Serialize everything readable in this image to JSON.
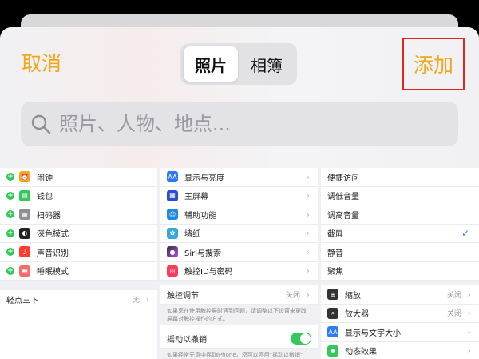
{
  "header": {
    "cancel": "取消",
    "add": "添加",
    "segments": [
      {
        "label": "照片",
        "active": true
      },
      {
        "label": "相簿",
        "active": false
      }
    ],
    "search_placeholder": "照片、人物、地点..."
  },
  "gallery": {
    "col1": {
      "items": [
        {
          "label": "闹钟",
          "icon": "alarm-icon",
          "color": "#f5a623"
        },
        {
          "label": "钱包",
          "icon": "wallet-icon",
          "color": "#34c759"
        },
        {
          "label": "扫码器",
          "icon": "qr-icon",
          "color": "#8e8e93"
        },
        {
          "label": "深色模式",
          "icon": "dark-mode-icon",
          "color": "#222222"
        },
        {
          "label": "声音识别",
          "icon": "sound-icon",
          "color": "#ff3b30"
        },
        {
          "label": "睡眠模式",
          "icon": "bed-icon",
          "color": "#ff6b6b"
        }
      ],
      "bottom_label": "轻点三下",
      "bottom_value": "无"
    },
    "col2": {
      "items": [
        {
          "label": "显示与亮度",
          "icon": "AA",
          "color": "#2d7cf6"
        },
        {
          "label": "主屏幕",
          "icon": "grid",
          "color": "#2d4bd3"
        },
        {
          "label": "辅助功能",
          "icon": "person",
          "color": "#1e88e5"
        },
        {
          "label": "墙纸",
          "icon": "flower",
          "color": "#36aadf"
        },
        {
          "label": "Siri与搜索",
          "icon": "siri",
          "color": "#333333"
        },
        {
          "label": "触控ID与密码",
          "icon": "fingerprint",
          "color": "#ff3b5c"
        }
      ],
      "touch_label": "触控调节",
      "touch_value": "关闭",
      "touch_note": "如果您在使用触控屏时遇到问题，请调整以下设置来更改屏幕对触控操作的方式。",
      "shake_label": "摇动以撤销",
      "shake_note": "如果经常无意中摇动iPhone，您可以停用\"摇动以撤销\""
    },
    "col3": {
      "items": [
        {
          "label": "便捷访问"
        },
        {
          "label": "调低音量"
        },
        {
          "label": "调高音量"
        },
        {
          "label": "截屏",
          "checked": true
        },
        {
          "label": "静音"
        },
        {
          "label": "聚焦"
        }
      ],
      "rows": [
        {
          "label": "缩放",
          "value": "关闭",
          "color": "#333333"
        },
        {
          "label": "放大器",
          "value": "关闭",
          "color": "#333333"
        },
        {
          "label": "显示与文字大小",
          "value": "",
          "color": "#2d7cf6"
        },
        {
          "label": "动态效果",
          "value": "",
          "color": "#34c759"
        }
      ]
    }
  },
  "colors": {
    "accent": "#f0a81a",
    "highlight": "#e0271d",
    "toggle": "#35c759"
  }
}
